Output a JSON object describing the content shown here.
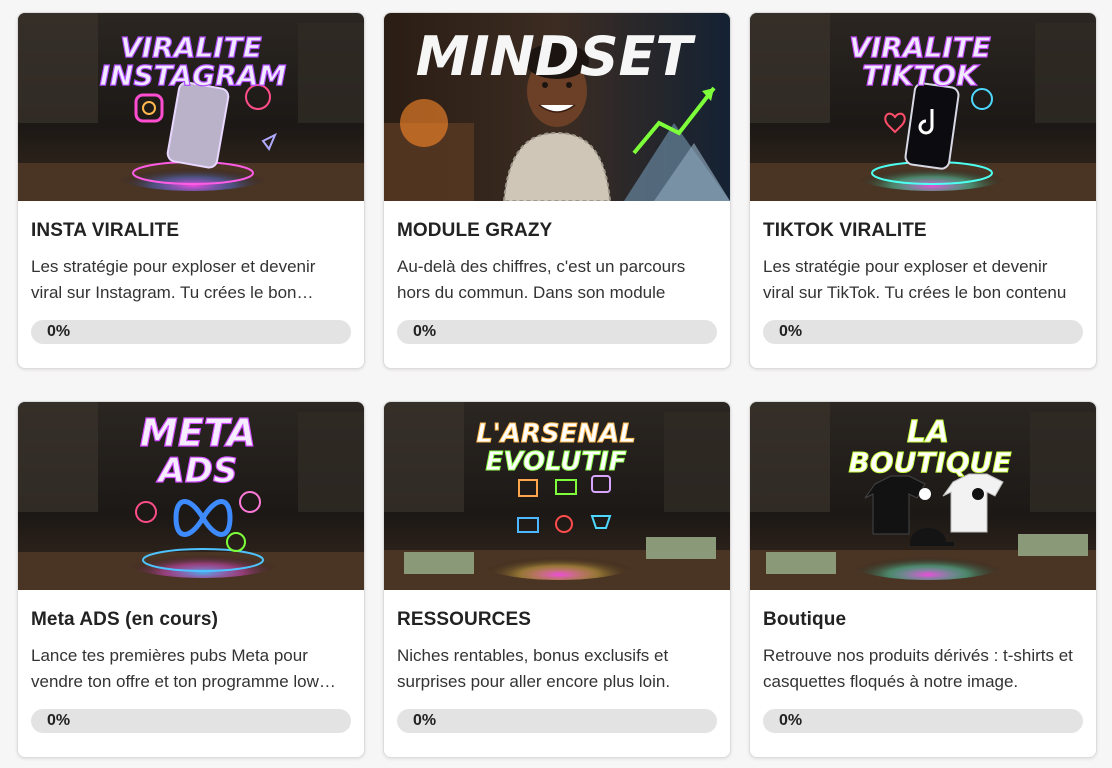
{
  "courses": [
    {
      "title": "INSTA VIRALITE",
      "description": "Les stratégie pour exploser et devenir viral sur Instagram. Tu crées le bon contenu",
      "progress_label": "0%",
      "progress": 0,
      "thumb_lines": [
        "VIRALITE",
        "INSTAGRAM"
      ],
      "thumb_color": "#e8e8ff",
      "thumb_glow": "#b04dff"
    },
    {
      "title": "MODULE GRAZY",
      "description": "Au-delà des chiffres, c'est un parcours hors du commun. Dans son module",
      "progress_label": "0%",
      "progress": 0,
      "thumb_lines": [
        "MINDSET"
      ],
      "thumb_color": "#ffffff",
      "thumb_glow": "#ff6a00"
    },
    {
      "title": "TIKTOK VIRALITE",
      "description": "Les stratégie pour exploser et devenir viral sur TikTok. Tu crées le bon contenu",
      "progress_label": "0%",
      "progress": 0,
      "thumb_lines": [
        "VIRALITE",
        "TIKTOK"
      ],
      "thumb_color": "#e8e8ff",
      "thumb_glow": "#c54dff"
    },
    {
      "title": "Meta ADS (en cours)",
      "description": "Lance tes premières pubs Meta pour vendre ton offre et ton programme low ticket",
      "progress_label": "0%",
      "progress": 0,
      "thumb_lines": [
        "META",
        "ADS"
      ],
      "thumb_color": "#f2e8ff",
      "thumb_glow": "#d04dff"
    },
    {
      "title": "RESSOURCES",
      "description": "Niches rentables, bonus exclusifs et surprises pour aller encore plus loin.",
      "progress_label": "0%",
      "progress": 0,
      "thumb_lines": [
        "L'ARSENAL",
        "EVOLUTIF"
      ],
      "thumb_color": "#ffffff",
      "thumb_glow": "#8fff4d"
    },
    {
      "title": "Boutique",
      "description": "Retrouve nos produits dérivés : t-shirts et casquettes floqués à notre image.",
      "progress_label": "0%",
      "progress": 0,
      "thumb_lines": [
        "LA",
        "BOUTIQUE"
      ],
      "thumb_color": "#ffffff",
      "thumb_glow": "#c8ff3d"
    }
  ]
}
